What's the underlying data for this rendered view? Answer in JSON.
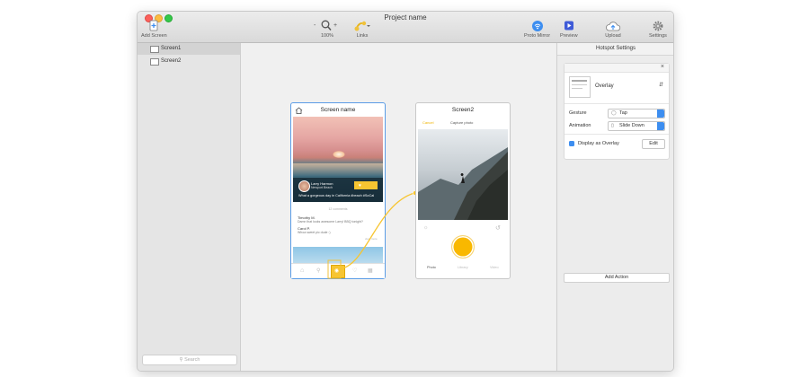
{
  "window": {
    "title": "Project name"
  },
  "toolbar": {
    "add_screen": "Add Screen",
    "zoom_minus": "-",
    "zoom_plus": "+",
    "zoom_level": "100%",
    "links": "Links",
    "proto_mirror": "Proto Mirror",
    "preview": "Preview",
    "upload": "Upload",
    "settings": "Settings"
  },
  "sidebar": {
    "screens": [
      {
        "label": "Screen1",
        "selected": true
      },
      {
        "label": "Screen2",
        "selected": false
      }
    ],
    "search_placeholder": "Search"
  },
  "screen1": {
    "title": "Screen name",
    "user_name": "Larry Harmon",
    "user_location": "Newport Beach",
    "caption": "What a gorgeous day in California #beach #SoCal",
    "comments_count": "12 comments",
    "comment1_author": "Timothy M.",
    "comment1_text": "Damn that looks awesome Larry! BBQ tonight?",
    "comment2_author": "Carol P.",
    "comment2_text": "Whoa sweet pic dude :)",
    "view_more": "view more"
  },
  "screen2": {
    "title": "Screen2",
    "cancel": "Cancel",
    "capture": "Capture photo",
    "tabs": [
      "Photo",
      "Library",
      "Video"
    ]
  },
  "hotspot": {
    "title": "Hotspot Settings",
    "overlay_label": "Overlay",
    "gesture_label": "Gesture",
    "gesture_value": "Tap",
    "animation_label": "Animation",
    "animation_value": "Slide Down",
    "display_overlay": "Display as Overlay",
    "display_overlay_checked": true,
    "edit": "Edit",
    "add_action": "Add Action",
    "close": "×"
  },
  "colors": {
    "accent": "#3d8ef0",
    "hotspot_yellow": "#f7c531",
    "shutter": "#f9b800"
  }
}
